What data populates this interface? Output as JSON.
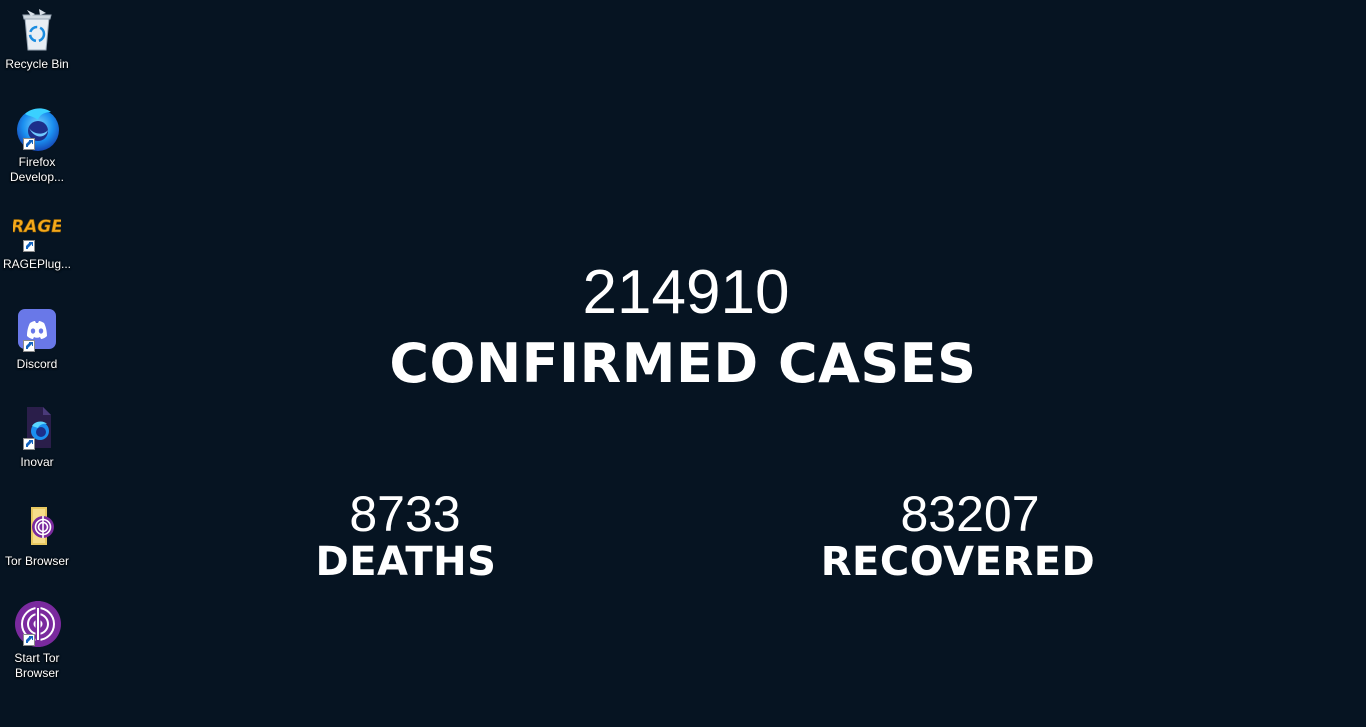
{
  "desktop": {
    "background_color": "#061422",
    "icons": [
      {
        "label": "Recycle Bin",
        "icon": "recycle-bin-icon",
        "shortcut": false
      },
      {
        "label": "Firefox\nDevelop...",
        "icon": "firefox-developer-icon",
        "shortcut": true
      },
      {
        "label": "RAGEPlug...",
        "icon": "rage-plugin-icon",
        "shortcut": true,
        "logo_text": "RAGE"
      },
      {
        "label": "Discord",
        "icon": "discord-icon",
        "shortcut": true
      },
      {
        "label": "Inovar",
        "icon": "inovar-icon",
        "shortcut": true
      },
      {
        "label": "Tor Browser",
        "icon": "tor-browser-folder-icon",
        "shortcut": false
      },
      {
        "label": "Start Tor\nBrowser",
        "icon": "start-tor-browser-icon",
        "shortcut": true
      }
    ]
  },
  "wallpaper": {
    "confirmed": {
      "value": "214910",
      "label": "CONFIRMED CASES"
    },
    "deaths": {
      "value": "8733",
      "label": "DEATHS"
    },
    "recovered": {
      "value": "83207",
      "label": "RECOVERED"
    }
  }
}
